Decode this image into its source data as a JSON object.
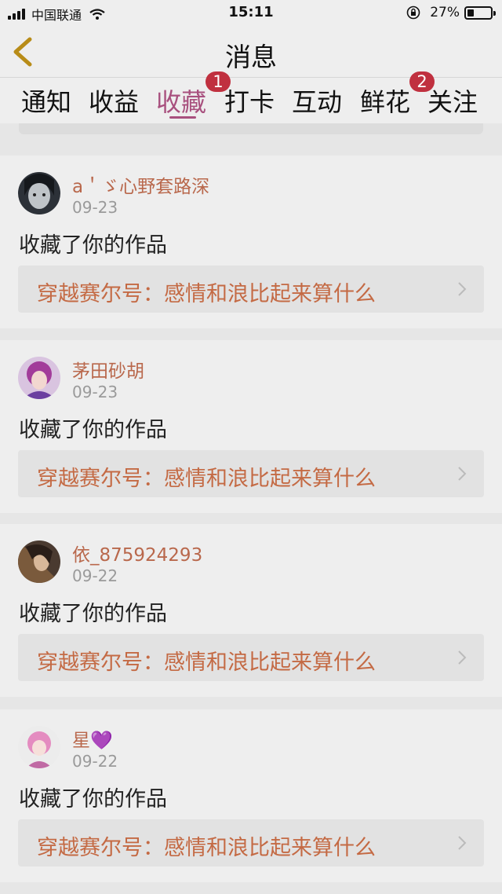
{
  "status_bar": {
    "carrier": "中国联通",
    "time": "15:11",
    "battery": "27%",
    "battery_level": 0.27,
    "icons": [
      "signal-icon",
      "wifi-icon",
      "rotation-lock-icon",
      "battery-icon"
    ]
  },
  "nav": {
    "title": "消息",
    "back_icon": "chevron-left-icon"
  },
  "tabs": [
    {
      "label": "通知",
      "badge": ""
    },
    {
      "label": "收益",
      "badge": ""
    },
    {
      "label": "收藏",
      "badge": "1",
      "active": true
    },
    {
      "label": "打卡",
      "badge": ""
    },
    {
      "label": "互动",
      "badge": ""
    },
    {
      "label": "鲜花",
      "badge": "2"
    },
    {
      "label": "关注",
      "badge": ""
    }
  ],
  "items": [
    {
      "user": "a＇ゞ心野套路深",
      "date": "09-23",
      "action": "收藏了你的作品",
      "work": "穿越赛尔号：感情和浪比起来算什么"
    },
    {
      "user": "茅田砂胡",
      "date": "09-23",
      "action": "收藏了你的作品",
      "work": "穿越赛尔号：感情和浪比起来算什么"
    },
    {
      "user": "依_875924293",
      "date": "09-22",
      "action": "收藏了你的作品",
      "work": "穿越赛尔号：感情和浪比起来算什么"
    },
    {
      "user": "星💜",
      "date": "09-22",
      "action": "收藏了你的作品",
      "work": "穿越赛尔号：感情和浪比起来算什么"
    }
  ],
  "colors": {
    "accent": "#a8507e",
    "badge": "#c0303f",
    "username": "#b9684c",
    "work_title": "#c46a44"
  }
}
